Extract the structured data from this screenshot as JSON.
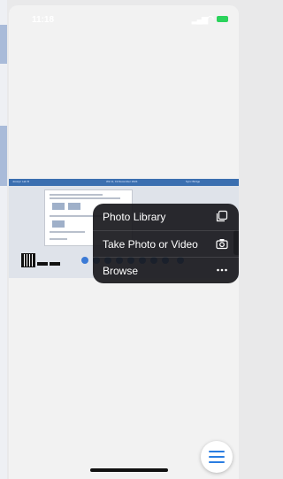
{
  "status_bar": {
    "time": "11:18"
  },
  "document_preview": {
    "header_left": "Jocelyn Lab B",
    "header_mid": "Wk 11, 19 December 2024",
    "header_right": "Sync Bridge"
  },
  "action_menu": {
    "items": [
      {
        "label": "Photo Library",
        "icon": "photo-library-icon"
      },
      {
        "label": "Take Photo or Video",
        "icon": "camera-icon"
      },
      {
        "label": "Browse",
        "icon": "ellipsis-icon"
      }
    ]
  },
  "colors": {
    "accent": "#2a7de1",
    "menu_bg": "#1c1c1f",
    "header_bar": "#3b6fb0"
  }
}
